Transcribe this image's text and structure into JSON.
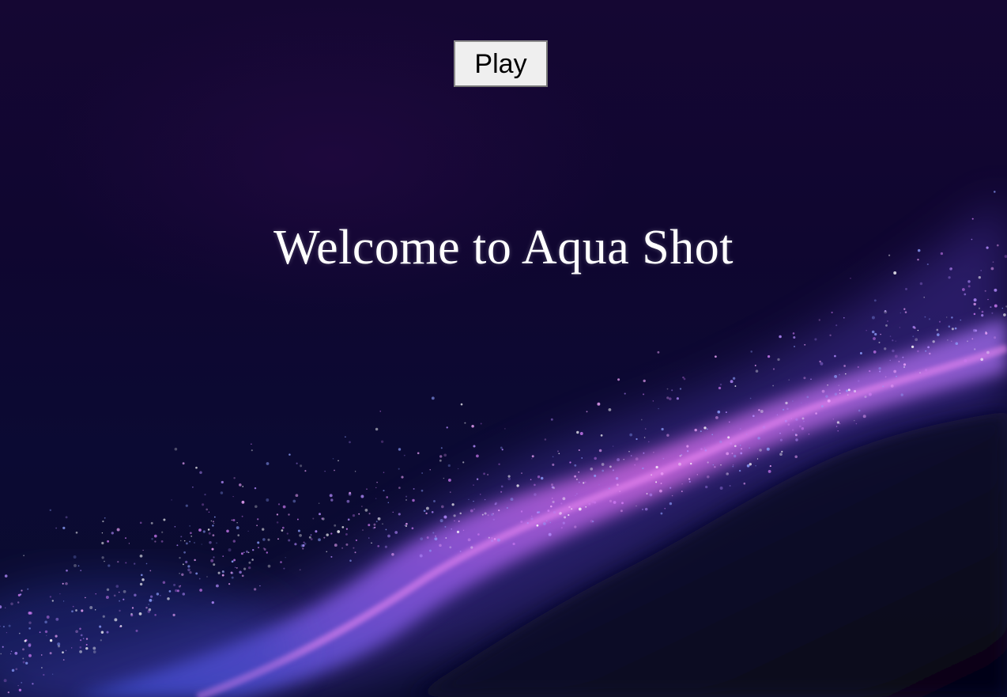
{
  "menu": {
    "play_label": "Play",
    "title": "Welcome to Aqua Shot"
  },
  "background": {
    "description_icon": "particle-wave-background",
    "colors": {
      "sky_top": "#150733",
      "sky_bottom": "#0a0c2e",
      "wave_pink": "#d06bf0",
      "wave_purple": "#8a5ce6",
      "wave_blue": "#4a5be8",
      "shadow_dark": "#07061a"
    }
  }
}
